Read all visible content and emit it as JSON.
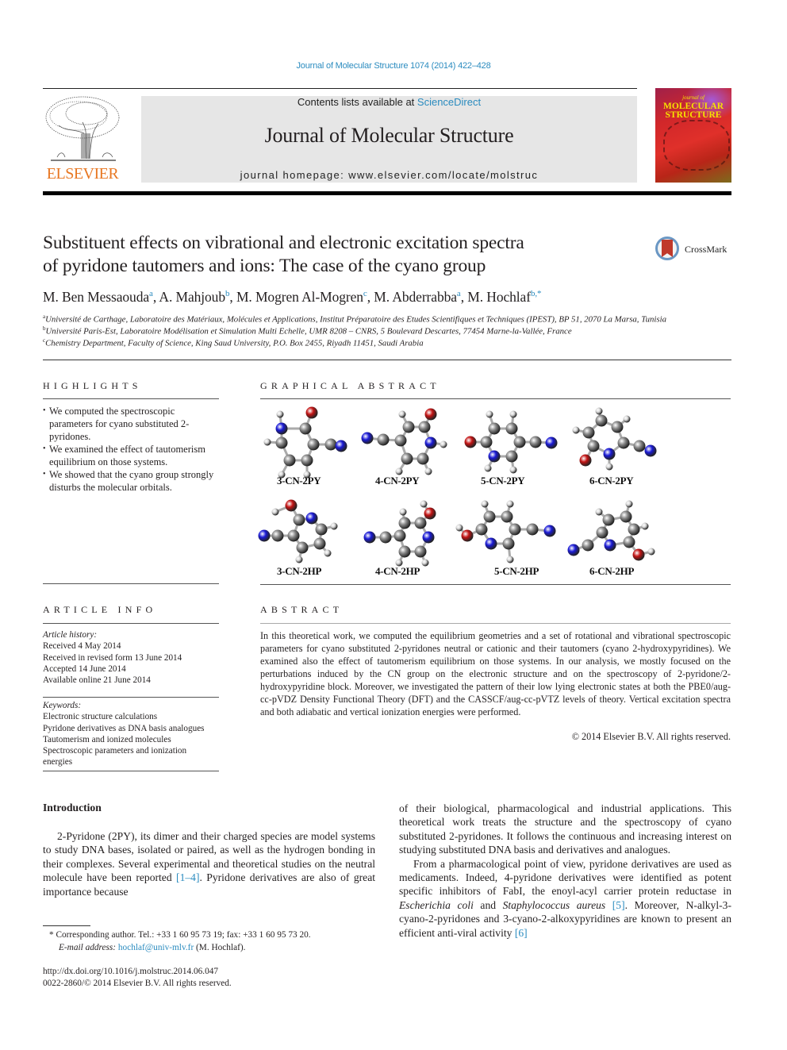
{
  "header": {
    "journal_reference": "Journal of Molecular Structure 1074 (2014) 422–428",
    "contents_prefix": "Contents lists available at ",
    "contents_link": "ScienceDirect",
    "journal_title": "Journal of Molecular Structure",
    "homepage": "journal homepage: www.elsevier.com/locate/molstruc",
    "publisher_logo_text": "ELSEVIER",
    "cover_small_text": "journal of",
    "cover_title_line1": "MOLECULAR",
    "cover_title_line2": "STRUCTURE",
    "publisher_color": "#e87722",
    "link_color": "#2a8bbf"
  },
  "article": {
    "title_line1": "Substituent effects on vibrational and electronic excitation spectra",
    "title_line2": "of pyridone tautomers and ions: The case of the cyano group",
    "crossmark_label": "CrossMark",
    "authors": [
      {
        "name": "M. Ben Messaouda",
        "affil": "a"
      },
      {
        "name": "A. Mahjoub",
        "affil": "b"
      },
      {
        "name": "M. Mogren Al-Mogren",
        "affil": "c"
      },
      {
        "name": "M. Abderrabba",
        "affil": "a"
      },
      {
        "name": "M. Hochlaf",
        "affil": "b,*"
      }
    ],
    "affiliations": [
      {
        "key": "a",
        "text": "Université de Carthage, Laboratoire des Matériaux, Molécules et Applications, Institut Préparatoire des Etudes Scientifiques et Techniques (IPEST), BP 51, 2070 La Marsa, Tunisia"
      },
      {
        "key": "b",
        "text": "Université Paris-Est, Laboratoire Modélisation et Simulation Multi Echelle, UMR 8208 – CNRS, 5 Boulevard Descartes, 77454 Marne-la-Vallée, France"
      },
      {
        "key": "c",
        "text": "Chemistry Department, Faculty of Science, King Saud University, P.O. Box 2455, Riyadh 11451, Saudi Arabia"
      }
    ]
  },
  "highlights": {
    "heading": "HIGHLIGHTS",
    "items": [
      "We computed the spectroscopic parameters for cyano substituted 2-pyridones.",
      "We examined the effect of tautomerism equilibrium on those systems.",
      "We showed that the cyano group strongly disturbs the molecular orbitals."
    ]
  },
  "graphical_abstract": {
    "heading": "GRAPHICAL ABSTRACT",
    "atom_colors": {
      "C": "#8a8a8a",
      "N": "#1a1ad6",
      "O": "#c41414",
      "H": "#d8d8d8"
    },
    "molecules": [
      {
        "label": "3-CN-2PY"
      },
      {
        "label": "4-CN-2PY"
      },
      {
        "label": "5-CN-2PY"
      },
      {
        "label": "6-CN-2PY"
      },
      {
        "label": "3-CN-2HP"
      },
      {
        "label": "4-CN-2HP"
      },
      {
        "label": "5-CN-2HP"
      },
      {
        "label": "6-CN-2HP"
      }
    ]
  },
  "article_info": {
    "heading": "ARTICLE INFO",
    "history_label": "Article history:",
    "history": [
      "Received 4 May 2014",
      "Received in revised form 13 June 2014",
      "Accepted 14 June 2014",
      "Available online 21 June 2014"
    ],
    "keywords_label": "Keywords:",
    "keywords": [
      "Electronic structure calculations",
      "Pyridone derivatives as DNA basis analogues",
      "Tautomerism and ionized molecules",
      "Spectroscopic parameters and ionization energies"
    ]
  },
  "abstract": {
    "heading": "ABSTRACT",
    "text": "In this theoretical work, we computed the equilibrium geometries and a set of rotational and vibrational spectroscopic parameters for cyano substituted 2-pyridones neutral or cationic and their tautomers (cyano 2-hydroxypyridines). We examined also the effect of tautomerism equilibrium on those systems. In our analysis, we mostly focused on the perturbations induced by the CN group on the electronic structure and on the spectroscopy of 2-pyridone/2-hydroxypyridine block. Moreover, we investigated the pattern of their low lying electronic states at both the PBE0/aug-cc-pVDZ Density Functional Theory (DFT) and the CASSCF/aug-cc-pVTZ levels of theory. Vertical excitation spectra and both adiabatic and vertical ionization energies were performed.",
    "copyright": "© 2014 Elsevier B.V. All rights reserved."
  },
  "introduction": {
    "heading": "Introduction",
    "left_p1_a": "2-Pyridone (2PY), its dimer and their charged species are model systems to study DNA bases, isolated or paired, as well as the hydrogen bonding in their complexes. Several experimental and theoretical studies on the neutral molecule have been reported ",
    "left_p1_ref": "[1–4]",
    "left_p1_b": ". Pyridone derivatives are also of great importance because",
    "right_p1": "of their biological, pharmacological and industrial applications. This theoretical work treats the structure and the spectroscopy of cyano substituted 2-pyridones. It follows the continuous and increasing interest on studying substituted DNA basis and derivatives and analogues.",
    "right_p2_a": "From a pharmacological point of view, pyridone derivatives are used as medicaments. Indeed, 4-pyridone derivatives were identified as potent specific inhibitors of FabI, the enoyl-acyl carrier protein reductase in ",
    "right_p2_i1": "Escherichia coli",
    "right_p2_b": " and ",
    "right_p2_i2": "Staphylococcus aureus",
    "right_p2_c": " ",
    "right_p2_ref1": "[5]",
    "right_p2_d": ". Moreover, N-alkyl-3-cyano-2-pyridones and 3-cyano-2-alkoxypyridines are known to present an efficient anti-viral activity ",
    "right_p2_ref2": "[6]"
  },
  "footnotes": {
    "corresponding": "* Corresponding author. Tel.: +33 1 60 95 73 19; fax: +33 1 60 95 73 20.",
    "email_label": "E-mail address: ",
    "email": "hochlaf@univ-mlv.fr",
    "email_suffix": " (M. Hochlaf).",
    "doi": "http://dx.doi.org/10.1016/j.molstruc.2014.06.047",
    "issn_line": "0022-2860/© 2014 Elsevier B.V. All rights reserved."
  }
}
